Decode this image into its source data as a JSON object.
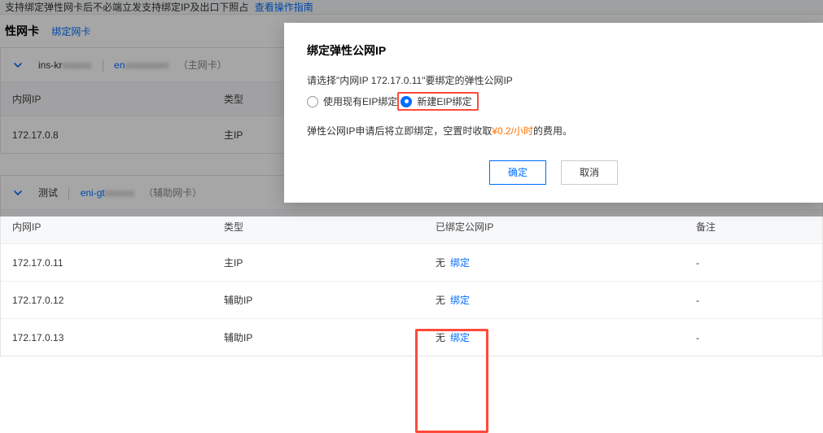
{
  "top_strip": {
    "text": "支持绑定弹性网卡后不必端立发支持绑定IP及出口下照占",
    "link": "查看操作指南"
  },
  "section": {
    "title": "性网卡",
    "bind_link": "绑定网卡"
  },
  "panel1": {
    "crumb_prefix": "ins-kr",
    "crumb_blur1": "xxxxxx",
    "eni_prefix": "en",
    "eni_blur": "xxxxxxxxx",
    "tag": "（主网卡）",
    "headers": {
      "ip": "内网IP",
      "type": "类型"
    },
    "rows": [
      {
        "ip": "172.17.0.8",
        "type": "主IP"
      }
    ]
  },
  "panel2": {
    "name": "测试",
    "eni_prefix": "eni-gt",
    "eni_blur": "xxxxxx",
    "tag": "（辅助网卡）",
    "headers": {
      "ip": "内网IP",
      "type": "类型",
      "eip": "已绑定公网IP",
      "note": "备注"
    },
    "rows": [
      {
        "ip": "172.17.0.11",
        "type": "主IP",
        "eip_none": "无",
        "eip_action": "绑定",
        "note": "-"
      },
      {
        "ip": "172.17.0.12",
        "type": "辅助IP",
        "eip_none": "无",
        "eip_action": "绑定",
        "note": "-"
      },
      {
        "ip": "172.17.0.13",
        "type": "辅助IP",
        "eip_none": "无",
        "eip_action": "绑定",
        "note": "-"
      }
    ]
  },
  "modal": {
    "title": "绑定弹性公网IP",
    "prompt": "请选择\"内网IP 172.17.0.11\"要绑定的弹性公网IP",
    "radio_existing": "使用现有EIP绑定",
    "radio_new": "新建EIP绑定",
    "fee_pre": "弹性公网IP申请后将立即绑定，空置时收取",
    "fee_price": "¥0.2/小时",
    "fee_post": "的费用。",
    "ok": "确定",
    "cancel": "取消"
  },
  "colors": {
    "link": "#006eff",
    "accent_red": "#ff4a3a",
    "price": "#ff7200"
  }
}
